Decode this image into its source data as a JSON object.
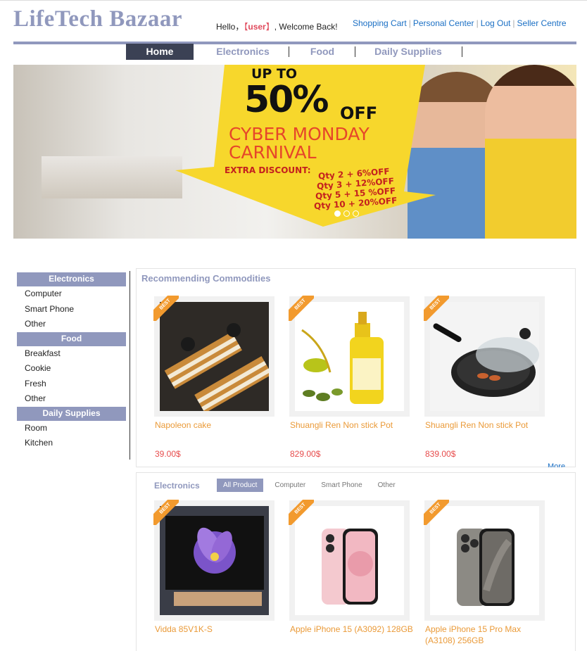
{
  "header": {
    "logo": "LifeTech Bazaar",
    "hello_prefix": "Hello，",
    "bracket_open": "【",
    "user": "user",
    "bracket_close": "】",
    "hello_suffix": ", Welcome Back!",
    "links": [
      "Shopping Cart",
      "Personal Center",
      "Log Out",
      "Seller Centre"
    ]
  },
  "nav": {
    "items": [
      "Home",
      "Electronics",
      "Food",
      "Daily Supplies"
    ],
    "active": "Home"
  },
  "banner": {
    "line1": "UP TO",
    "line2": "50%",
    "line2b": "OFF",
    "line3": "CYBER MONDAY",
    "line4": "CARNIVAL",
    "discount_label": "EXTRA DISCOUNT:",
    "discounts": [
      "Qty 2 + 6%OFF",
      "Qty 3 + 12%OFF",
      "Qty 5 + 15 %OFF",
      "Qty 10 + 20%OFF"
    ],
    "slides": 3,
    "active_slide": 1
  },
  "sidebar": {
    "categories": [
      {
        "name": "Electronics",
        "items": [
          "Computer",
          "Smart Phone",
          "Other"
        ]
      },
      {
        "name": "Food",
        "items": [
          "Breakfast",
          "Cookie",
          "Fresh",
          "Other"
        ]
      },
      {
        "name": "Daily Supplies",
        "items": [
          "Room",
          "Kitchen"
        ]
      }
    ]
  },
  "recommend": {
    "title": "Recommending Commodities",
    "more": "More",
    "products": [
      {
        "name": "Napoleon cake",
        "price": "39.00$",
        "badge": "BEST"
      },
      {
        "name": "Shuangli Ren Non stick Pot",
        "price": "829.00$",
        "badge": "BEST"
      },
      {
        "name": "Shuangli Ren Non stick Pot",
        "price": "839.00$",
        "badge": "BEST"
      }
    ]
  },
  "electronics": {
    "title": "Electronics",
    "tabs": [
      "All Product",
      "Computer",
      "Smart Phone",
      "Other"
    ],
    "active_tab": "All Product",
    "products": [
      {
        "name": "Vidda 85V1K-S",
        "badge": "BEST"
      },
      {
        "name": "Apple iPhone 15 (A3092) 128GB",
        "badge": "BEST"
      },
      {
        "name": "Apple iPhone 15 Pro Max (A3108) 256GB",
        "badge": "BEST"
      }
    ]
  },
  "colors": {
    "accent": "#9098bd",
    "link": "#1a6fc4",
    "product_name": "#ea9a38",
    "price": "#e74c4c",
    "banner_yellow": "#f7d72c"
  }
}
